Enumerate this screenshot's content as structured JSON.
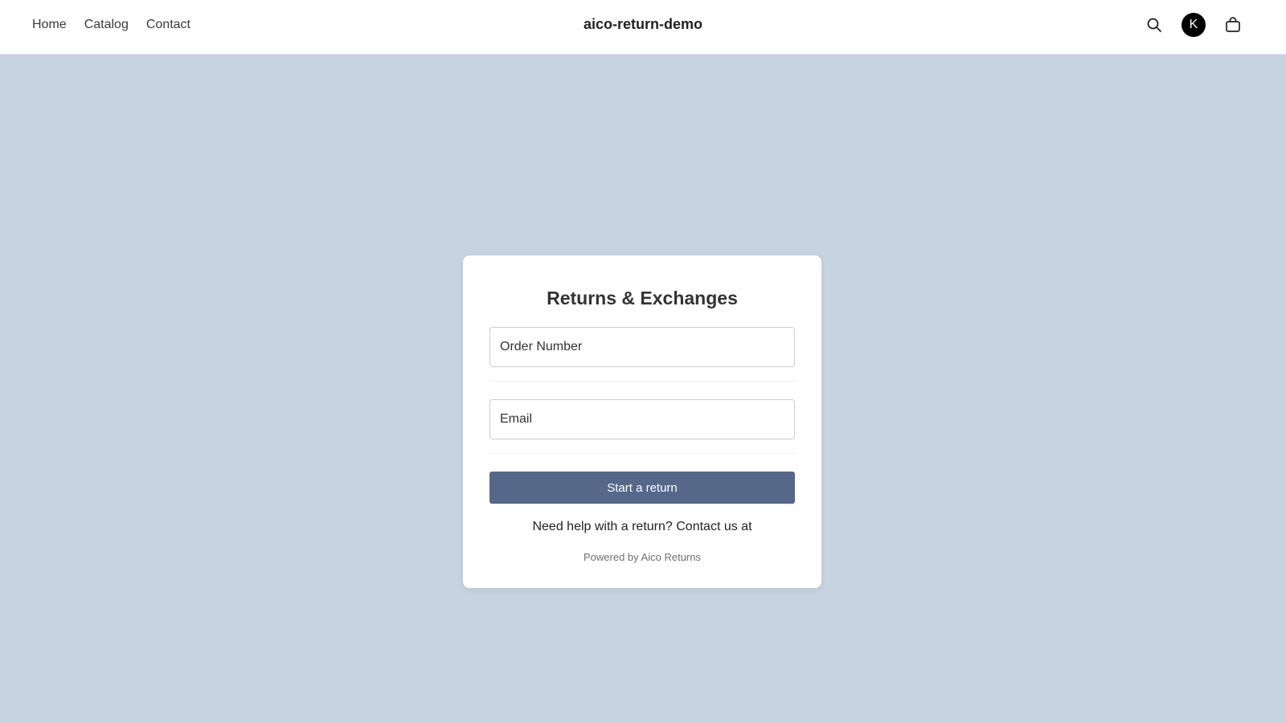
{
  "header": {
    "nav": [
      "Home",
      "Catalog",
      "Contact"
    ],
    "site_title": "aico-return-demo",
    "avatar_initial": "K",
    "icons": [
      "search-icon",
      "avatar",
      "shopping-bag-icon"
    ]
  },
  "form": {
    "title": "Returns & Exchanges",
    "order_number_placeholder": "Order Number",
    "email_placeholder": "Email",
    "submit_label": "Start a return",
    "help_text": "Need help with a return? Contact us at",
    "powered_by": "Powered by Aico Returns"
  },
  "colors": {
    "page_background": "#c8d3e0",
    "button": "#56688a"
  }
}
